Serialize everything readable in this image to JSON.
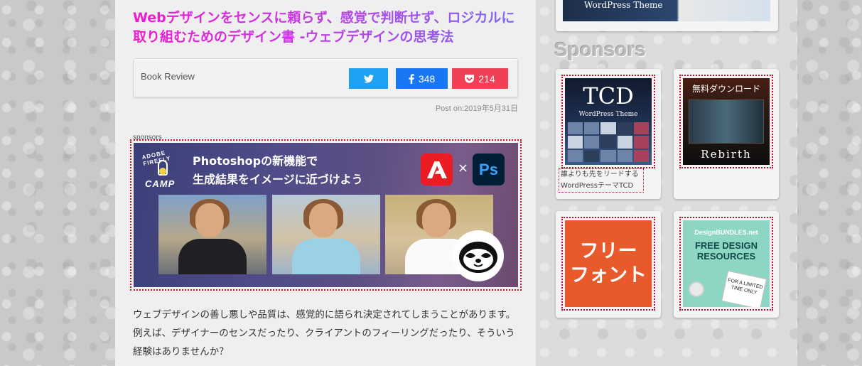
{
  "post": {
    "title": "Webデザインをセンスに頼らず、感覚で判断せず、ロジカルに取り組むためのデザイン書 -ウェブデザインの思考法",
    "category": "Book Review",
    "share": {
      "twitter_label": "",
      "facebook_count": "348",
      "pocket_count": "214"
    },
    "date": "Post on:2019年5月31日",
    "sponsor_label": "sponsors",
    "body": "ウェブデザインの善し悪しや品質は、感覚的に語られ決定されてしまうことがあります。例えば、デザイナーのセンスだったり、クライアントのフィーリングだったり、そういう経験はありませんか？"
  },
  "ad_banner": {
    "logo_arc": "ADOBE FIREFLY",
    "logo_camp": "CAMP",
    "headline_1": "Photoshopの新機能で",
    "headline_2": "生成結果をイメージに近づけよう",
    "times": "×",
    "ps": "Ps"
  },
  "sidebar": {
    "top_thumb_text": "WordPress Theme",
    "sponsors_heading": "Sponsors",
    "tcd": {
      "title": "TCD",
      "subtitle": "WordPress Theme",
      "caption": "誰よりも先をリードするWordPressテーマTCD"
    },
    "rebirth": {
      "download": "無料ダウンロード",
      "word": "Rebirth"
    },
    "freefont": {
      "line1": "フリー",
      "line2": "フォント"
    },
    "designbundles": {
      "logo": "DesignBUNDLES.net",
      "title_1": "FREE DESIGN",
      "title_2": "RESOURCES",
      "note": "FOR A LIMITED TIME ONLY"
    }
  },
  "colors": {
    "twitter": "#1da1f2",
    "facebook": "#1877f2",
    "pocket": "#ef4056",
    "title_gradient_start": "#f01ad0",
    "title_gradient_end": "#7a6af0"
  }
}
